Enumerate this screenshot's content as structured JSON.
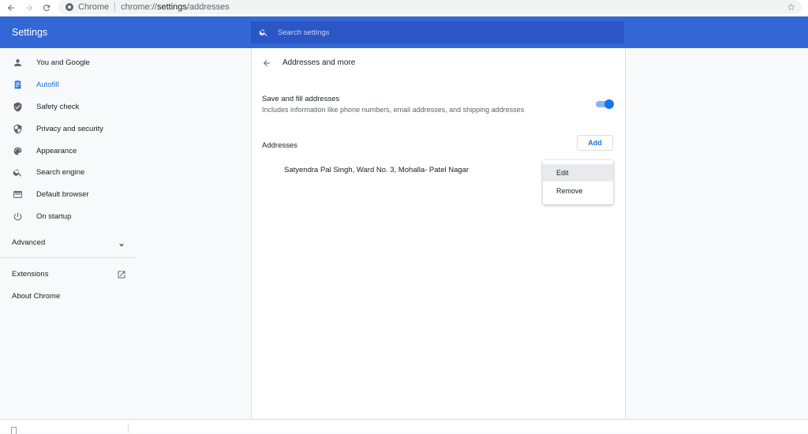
{
  "browser": {
    "site_name": "Chrome",
    "url_scheme": "chrome://",
    "url_host": "settings",
    "url_path": "/addresses",
    "star_icon": "star-icon"
  },
  "header": {
    "title": "Settings",
    "search_placeholder": "Search settings"
  },
  "sidebar": {
    "items": [
      {
        "label": "You and Google",
        "icon": "person-icon",
        "active": false
      },
      {
        "label": "Autofill",
        "icon": "clipboard-icon",
        "active": true
      },
      {
        "label": "Safety check",
        "icon": "shield-check-icon",
        "active": false
      },
      {
        "label": "Privacy and security",
        "icon": "shield-icon",
        "active": false
      },
      {
        "label": "Appearance",
        "icon": "palette-icon",
        "active": false
      },
      {
        "label": "Search engine",
        "icon": "search-icon",
        "active": false
      },
      {
        "label": "Default browser",
        "icon": "browser-icon",
        "active": false
      },
      {
        "label": "On startup",
        "icon": "power-icon",
        "active": false
      }
    ],
    "advanced": "Advanced",
    "extensions": "Extensions",
    "about": "About Chrome"
  },
  "main": {
    "page_title": "Addresses and more",
    "toggle": {
      "title": "Save and fill addresses",
      "description": "Includes information like phone numbers, email addresses, and shipping addresses",
      "enabled": true
    },
    "addresses_heading": "Addresses",
    "add_label": "Add",
    "address_entries": [
      "Satyendra Pal Singh, Ward No. 3, Mohalla- Patel Nagar"
    ],
    "menu": {
      "edit": "Edit",
      "remove": "Remove"
    }
  },
  "colors": {
    "accent": "#1a73e8",
    "header": "#3367d6",
    "search": "#2a56c6"
  }
}
